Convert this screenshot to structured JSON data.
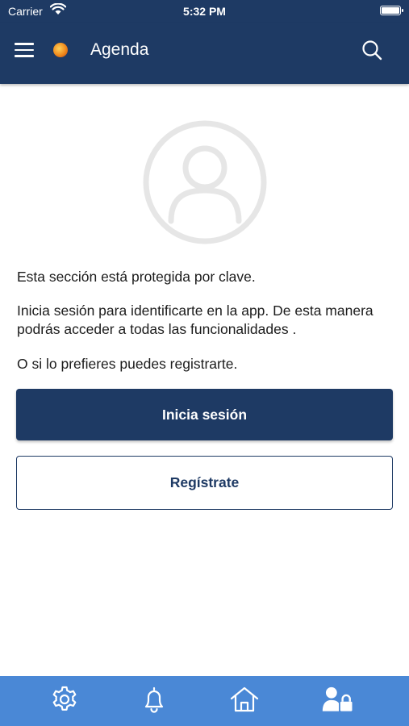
{
  "status_bar": {
    "carrier": "Carrier",
    "time": "5:32 PM",
    "icons": [
      "wifi-icon",
      "battery-icon"
    ]
  },
  "header": {
    "title": "Agenda",
    "menu_icon": "hamburger-menu-icon",
    "logo_icon": "app-logo-icon",
    "search_icon": "search-icon"
  },
  "main": {
    "avatar_icon": "user-avatar-icon",
    "protected_text": "Esta sección está protegida por clave.",
    "login_prompt": "Inicia sesión para identificarte en la app. De esta manera podrás acceder a todas las funcionalidades .",
    "register_prompt": "O si lo prefieres puedes registrarte.",
    "login_button": "Inicia sesión",
    "register_button": "Regístrate"
  },
  "tab_bar": {
    "items": [
      "gear-icon",
      "bell-icon",
      "home-icon",
      "user-lock-icon"
    ]
  },
  "colors": {
    "primary": "#1e3a64",
    "tab_bar": "#4a88d6",
    "avatar": "#e6e6e6",
    "text": "#1c1c1c"
  }
}
